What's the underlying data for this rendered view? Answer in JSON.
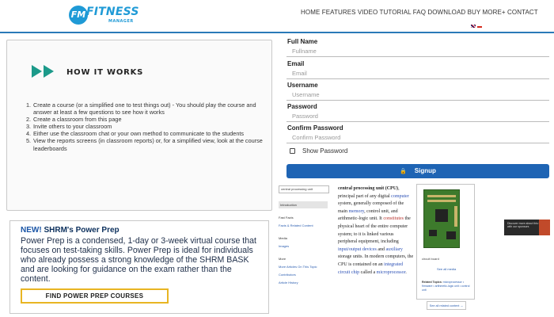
{
  "header": {
    "logo_badge": "FM",
    "logo_word": "FITNESS",
    "logo_sub": "MANAGER",
    "nav_text": "HOME FEATURES VIDEO TUTORIAL FAQ DOWNLOAD BUY MORE+ CONTACT"
  },
  "how_it_works": {
    "title": "HOW IT WORKS",
    "steps": [
      {
        "num": "1.",
        "text": "Create a course (or a simplified one to test things out) - You should play the course and answer at least a few questions to see how it works"
      },
      {
        "num": "2.",
        "text": "Create a classroom from this page"
      },
      {
        "num": "3.",
        "text": "Invite others to your classroom"
      },
      {
        "num": "4.",
        "text": "Either use the classroom chat or your own method to communicate to the students"
      },
      {
        "num": "5.",
        "text": "View the reports screens (in classroom reports) or, for a simplified view, look at the course leaderboards"
      }
    ]
  },
  "shrm": {
    "new_label": "NEW!",
    "title": " SHRM's Power Prep",
    "body": "Power Prep is a condensed, 1-day or 3-week virtual course that focuses on test-taking skills. Power Prep is ideal for individuals who already possess a strong knowledge of the SHRM BASK and are looking for guidance on the exam rather than the content.",
    "button": "FIND POWER PREP COURSES"
  },
  "signup_form": {
    "fields": [
      {
        "label": "Full Name",
        "placeholder": "Fullname"
      },
      {
        "label": "Email",
        "placeholder": "Email"
      },
      {
        "label": "Username",
        "placeholder": "Username"
      },
      {
        "label": "Password",
        "placeholder": "Password"
      },
      {
        "label": "Confirm Password",
        "placeholder": "Confirm Password"
      }
    ],
    "show_password": "Show Password",
    "submit": "Signup"
  },
  "embedded_page": {
    "select_value": "central processing unit",
    "sidebar": [
      {
        "text": "Introduction",
        "highlight": true
      },
      {
        "text": "Fast Facts"
      },
      {
        "text": "Facts & Related Content",
        "link": true
      },
      {
        "text": "Media"
      },
      {
        "text": "Images",
        "link": true
      },
      {
        "text": "More"
      },
      {
        "text": "More Articles On This Topic",
        "link": true
      },
      {
        "text": "Contributors",
        "link": true
      },
      {
        "text": "Article History",
        "link": true
      }
    ],
    "article": {
      "term": "central processing unit (CPU)",
      "t1": ", principal part of any digital ",
      "l1": "computer",
      "t2": " system, generally composed of the main ",
      "l2": "memory",
      "t3": ", control unit, and arithmetic-logic unit. It ",
      "r1": "constitutes",
      "t4": " the physical heart of the entire computer system; to it is linked various peripheral equipment, including ",
      "l3": "input/output devices",
      "t5": " and ",
      "l4": "auxiliary",
      "t6": " storage units. In modern computers, the CPU is contained on an ",
      "l5": "integrated circuit chip",
      "t7": " called a ",
      "l6": "microprocessor",
      "t8": "."
    },
    "infobox": {
      "caption": "circuit board",
      "see_all_media": "See all media",
      "related_label": "Related Topics:",
      "related_text": "microprocessor • firmware • arithmetic-logic unit • control unit",
      "see_all_related": "See all related content →"
    },
    "ad_text": "Discover more about this topic with our sponsors"
  }
}
